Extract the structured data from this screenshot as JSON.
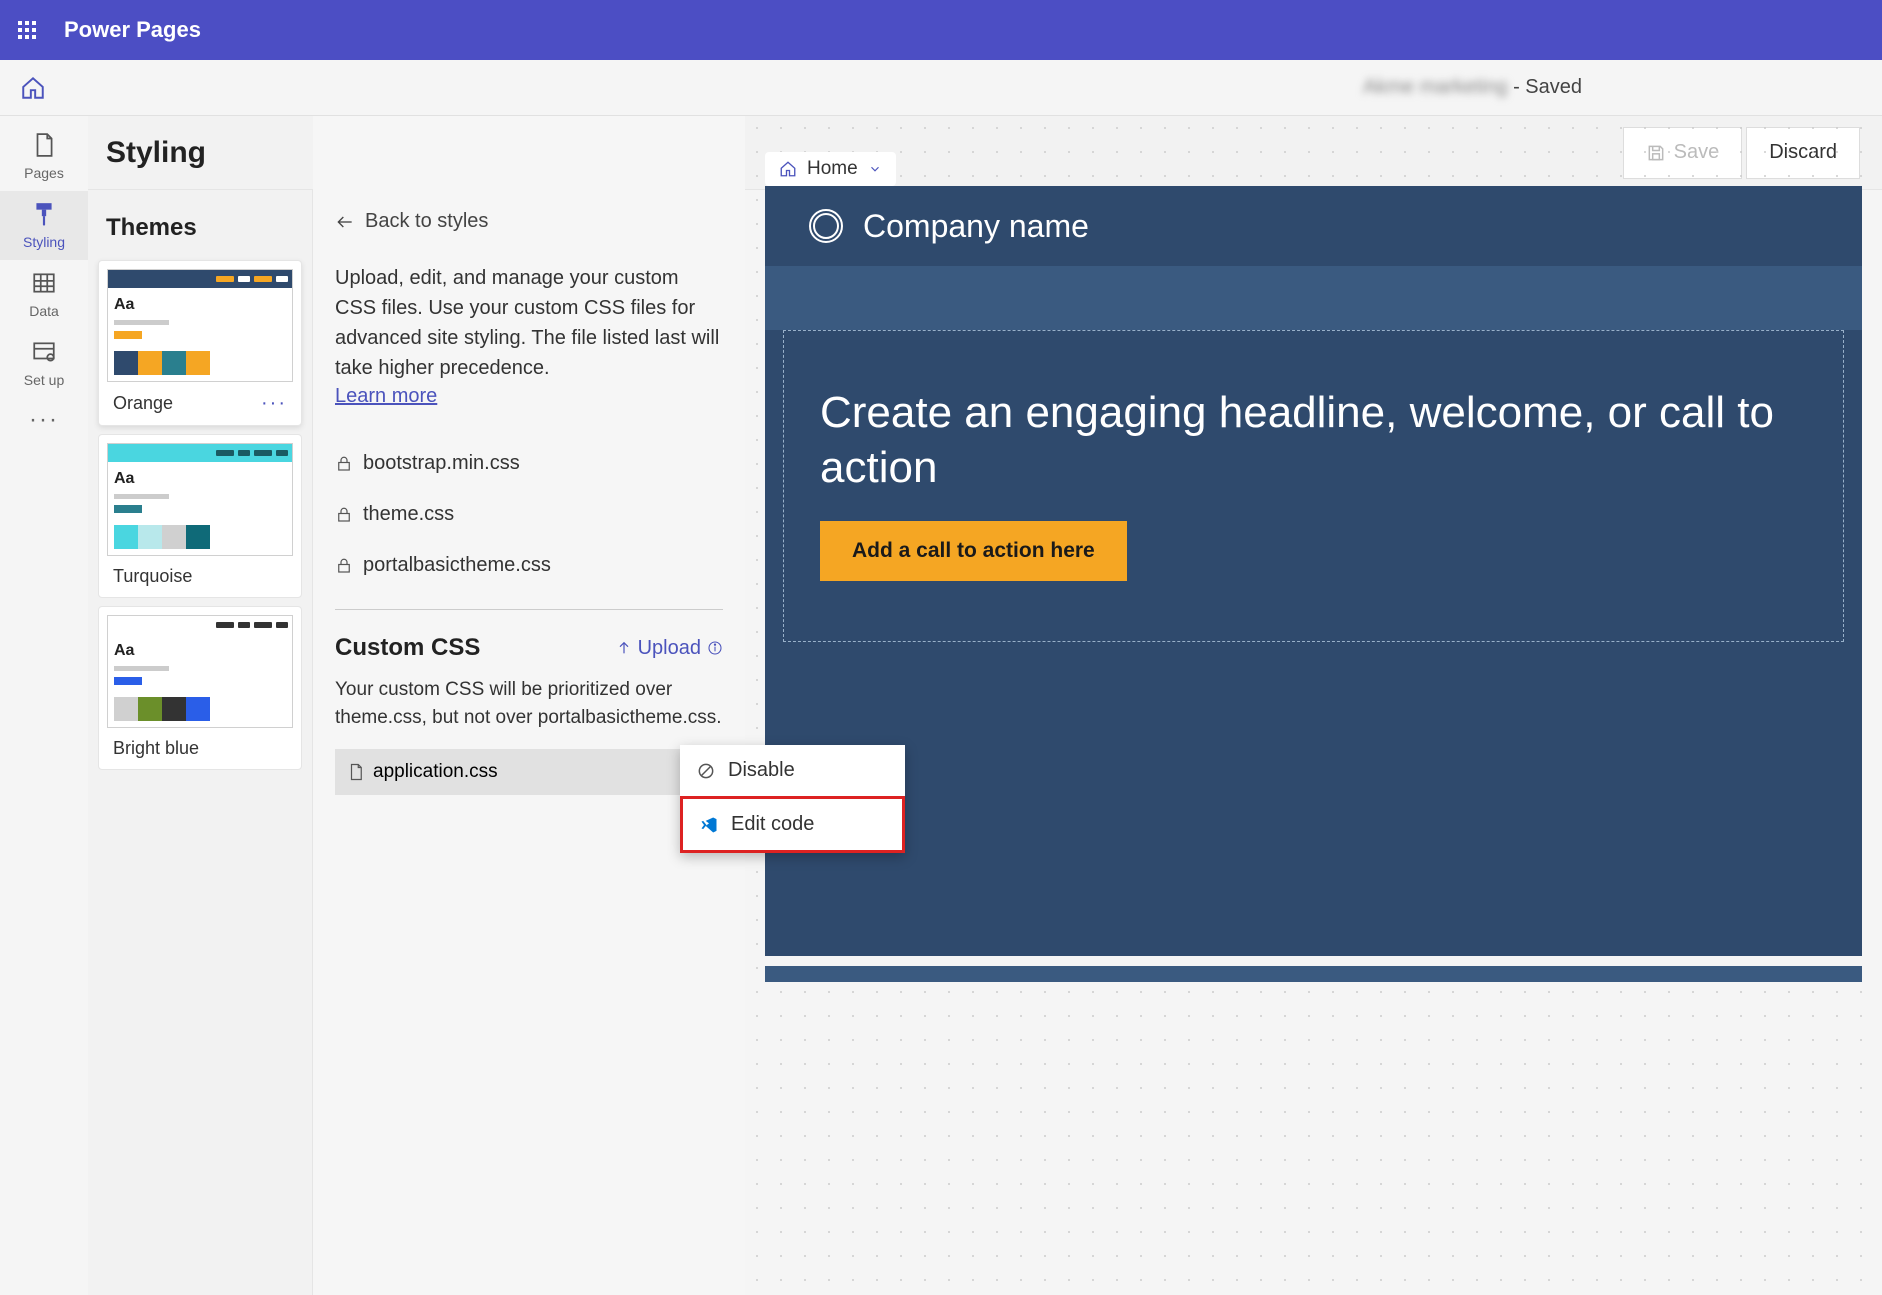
{
  "app": {
    "title": "Power Pages"
  },
  "subbar": {
    "site_name": "Akme marketing",
    "status_suffix": " - Saved"
  },
  "rail": {
    "items": [
      {
        "id": "pages",
        "label": "Pages"
      },
      {
        "id": "styling",
        "label": "Styling"
      },
      {
        "id": "data",
        "label": "Data"
      },
      {
        "id": "setup",
        "label": "Set up"
      }
    ]
  },
  "styling": {
    "title": "Styling",
    "save_label": "Save",
    "discard_label": "Discard",
    "themes_label": "Themes",
    "themes": [
      {
        "name": "Orange",
        "bar": "#2f4a6d",
        "accent": "#f5a623",
        "swatches": [
          "#2f4a6d",
          "#f5a623",
          "#2a7f8e",
          "#f5a623"
        ],
        "bars": [
          "#f5a623",
          "#fff",
          "#f5a623",
          "#fff"
        ]
      },
      {
        "name": "Turquoise",
        "bar": "#4ad6e0",
        "accent": "#2a7f8e",
        "swatches": [
          "#4ad6e0",
          "#b8e8eb",
          "#d0d0d0",
          "#0f6a78"
        ],
        "bars": [
          "#1a5a62",
          "#1a5a62",
          "#1a5a62",
          "#1a5a62"
        ]
      },
      {
        "name": "Bright blue",
        "bar": "#ffffff",
        "accent": "#2a5ee8",
        "swatches": [
          "#d0d0d0",
          "#6b8f2a",
          "#333333",
          "#2a5ee8"
        ],
        "bars": [
          "#333",
          "#333",
          "#333",
          "#333"
        ]
      }
    ]
  },
  "css_panel": {
    "back_label": "Back to styles",
    "description": "Upload, edit, and manage your custom CSS files. Use your custom CSS files for advanced site styling. The file listed last will take higher precedence.",
    "learn_more": "Learn more",
    "locked_files": [
      "bootstrap.min.css",
      "theme.css",
      "portalbasictheme.css"
    ],
    "custom_title": "Custom CSS",
    "upload_label": "Upload",
    "custom_desc": "Your custom CSS will be prioritized over theme.css, but not over portalbasictheme.css.",
    "custom_files": [
      "application.css"
    ]
  },
  "context_menu": {
    "disable": "Disable",
    "edit_code": "Edit code"
  },
  "preview": {
    "breadcrumb": "Home",
    "company": "Company name",
    "headline": "Create an engaging headline, welcome, or call to action",
    "cta": "Add a call to action here"
  }
}
